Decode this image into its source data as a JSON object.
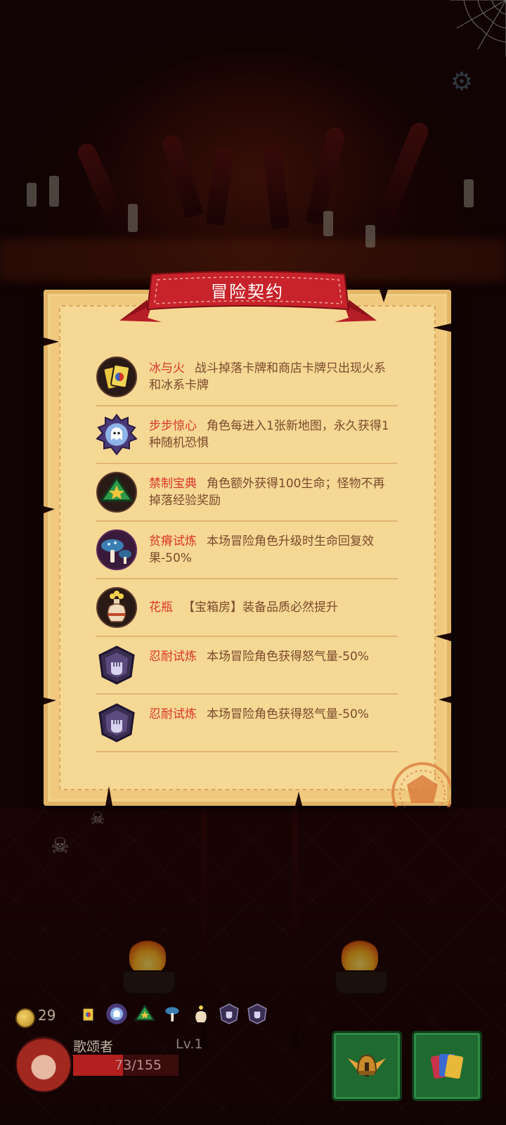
{
  "dialog": {
    "title": "冒险契约",
    "contracts": [
      {
        "name": "冰与火",
        "desc": "战斗掉落卡牌和商店卡牌只出现火系和冰系卡牌",
        "icon": "ice-fire-cards-icon"
      },
      {
        "name": "步步惊心",
        "desc": "角色每进入1张新地图，永久获得1种随机恐惧",
        "icon": "ghost-badge-icon"
      },
      {
        "name": "禁制宝典",
        "desc": "角色额外获得100生命；怪物不再掉落经验奖励",
        "icon": "forbidden-tome-icon"
      },
      {
        "name": "贫瘠试炼",
        "desc": "本场冒险角色升级时生命回复效果-50%",
        "icon": "mushroom-icon"
      },
      {
        "name": "花瓶",
        "desc": "【宝箱房】装备品质必然提升",
        "icon": "vase-icon"
      },
      {
        "name": "忍耐试炼",
        "desc": "本场冒险角色获得怒气量-50%",
        "icon": "fist-shield-icon"
      },
      {
        "name": "忍耐试炼",
        "desc": "本场冒险角色获得怒气量-50%",
        "icon": "fist-shield-icon"
      }
    ]
  },
  "hud": {
    "coins": "29",
    "hero_name": "歌颂者",
    "level": "Lv.1",
    "hp_text": "73/155",
    "hp_fraction": 0.47,
    "contract_icons": [
      "ice-fire-cards-icon",
      "ghost-badge-icon",
      "forbidden-tome-icon",
      "mushroom-icon",
      "vase-icon",
      "fist-shield-icon",
      "fist-shield-icon"
    ]
  },
  "colors": {
    "parchment": "#f0c97e",
    "banner_red": "#c8232b",
    "contract_name": "#d9362a",
    "contract_desc": "#7a4a2c",
    "button_green": "#1f6a30"
  }
}
